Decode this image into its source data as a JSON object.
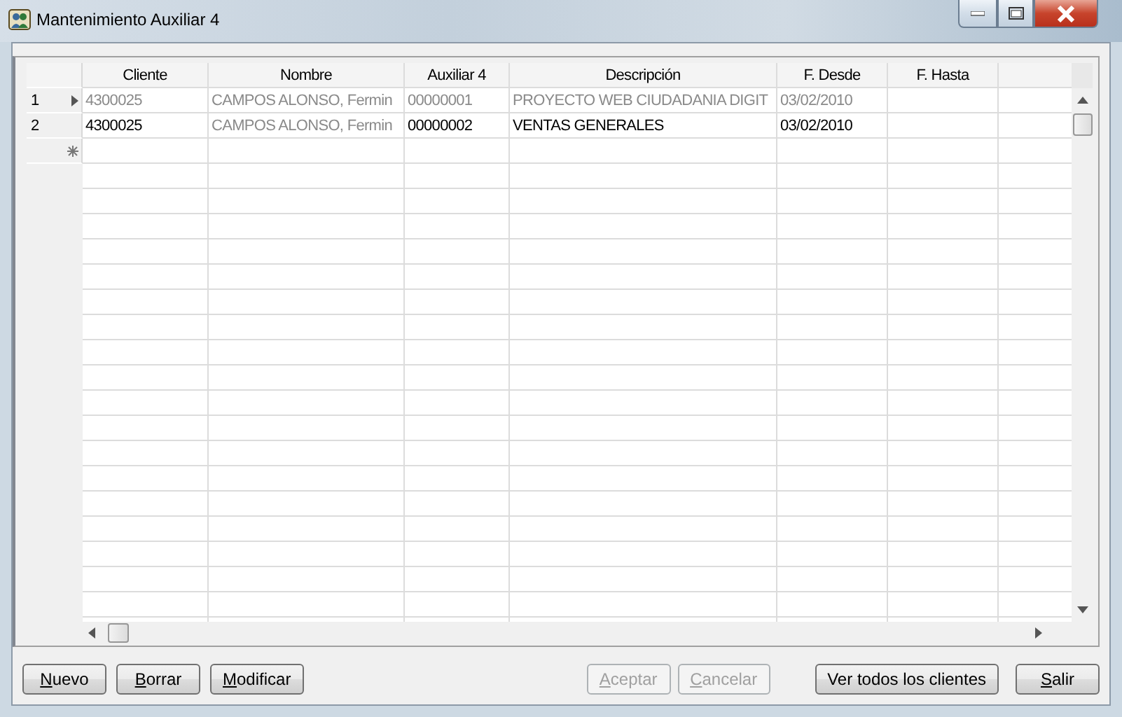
{
  "window": {
    "title": "Mantenimiento Auxiliar 4"
  },
  "table": {
    "columns": [
      "Cliente",
      "Nombre",
      "Auxiliar 4",
      "Descripción",
      "F. Desde",
      "F. Hasta"
    ],
    "rows": [
      {
        "number": "1",
        "current": true,
        "cells": [
          {
            "text": "4300025",
            "dimmed": true
          },
          {
            "text": "CAMPOS ALONSO, Fermin",
            "dimmed": true
          },
          {
            "text": "00000001",
            "dimmed": true
          },
          {
            "text": "PROYECTO WEB CIUDADANIA DIGIT",
            "dimmed": true
          },
          {
            "text": "03/02/2010",
            "dimmed": true
          }
        ]
      },
      {
        "number": "2",
        "current": false,
        "cells": [
          {
            "text": "4300025",
            "dimmed": false
          },
          {
            "text": "CAMPOS ALONSO, Fermin",
            "dimmed": true
          },
          {
            "text": "00000002",
            "dimmed": false
          },
          {
            "text": "VENTAS GENERALES",
            "dimmed": false
          },
          {
            "text": "03/02/2010",
            "dimmed": false
          }
        ]
      }
    ]
  },
  "buttons_left": [
    {
      "key": "N",
      "rest": "uevo",
      "disabled": false
    },
    {
      "key": "B",
      "rest": "orrar",
      "disabled": false
    },
    {
      "key": "M",
      "rest": "odificar",
      "disabled": false
    }
  ],
  "buttons_right": [
    {
      "key": "A",
      "rest": "ceptar",
      "disabled": true
    },
    {
      "key": "C",
      "rest": "ancelar",
      "disabled": true
    },
    {
      "rest": "Ver todos los clientes",
      "disabled": false
    },
    {
      "key": "S",
      "rest": "alir",
      "disabled": false
    }
  ]
}
